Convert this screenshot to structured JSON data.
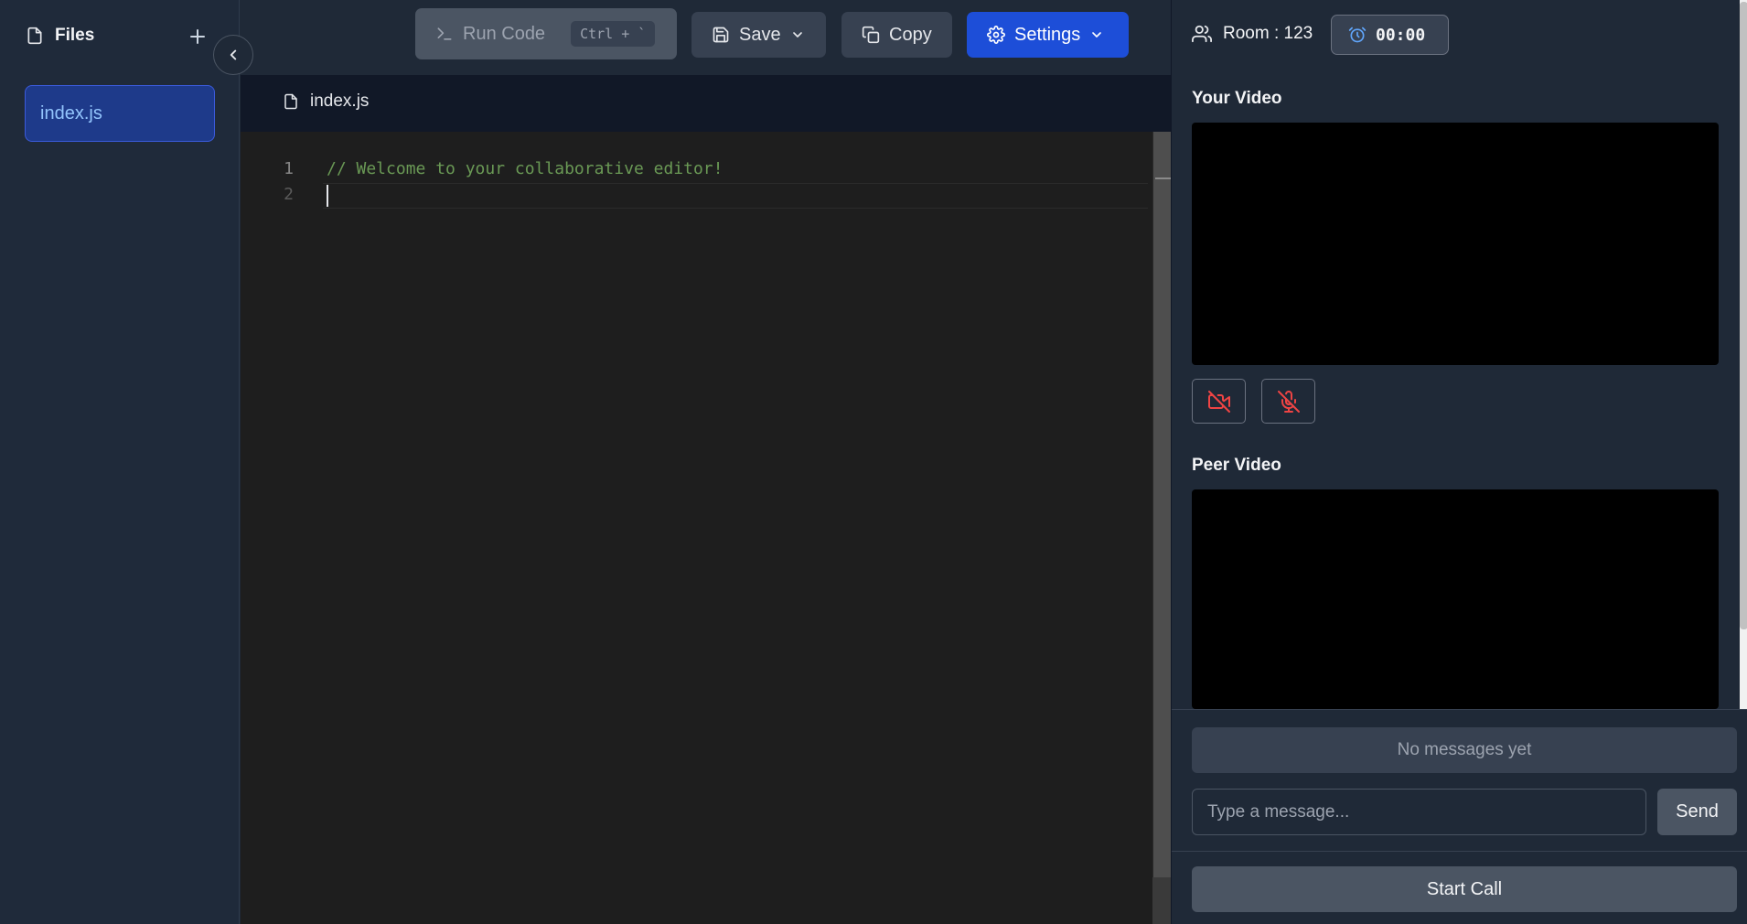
{
  "sidebar": {
    "title": "Files",
    "files": [
      {
        "name": "index.js",
        "active": true
      }
    ]
  },
  "toolbar": {
    "run_label": "Run Code",
    "run_shortcut": "Ctrl + `",
    "save_label": "Save",
    "copy_label": "Copy",
    "settings_label": "Settings"
  },
  "editor": {
    "tab_name": "index.js",
    "lines": [
      {
        "number": "1",
        "text": "// Welcome to your collaborative editor!"
      },
      {
        "number": "2",
        "text": ""
      }
    ]
  },
  "room": {
    "label": "Room : 123",
    "timer": "00:00"
  },
  "video": {
    "your_title": "Your Video",
    "peer_title": "Peer Video"
  },
  "chat": {
    "empty_text": "No messages yet",
    "input_placeholder": "Type a message...",
    "input_value": "",
    "send_label": "Send",
    "start_call_label": "Start Call"
  },
  "colors": {
    "accent": "#1d4ed8",
    "active_file_bg": "#1e3a8a",
    "media_off": "#ef4444",
    "comment": "#6a9955"
  },
  "icons": [
    "file-icon",
    "plus-icon",
    "chevron-left-icon",
    "terminal-icon",
    "save-icon",
    "chevron-down-icon",
    "copy-icon",
    "gear-icon",
    "users-icon",
    "alarm-clock-icon",
    "video-off-icon",
    "mic-off-icon"
  ]
}
